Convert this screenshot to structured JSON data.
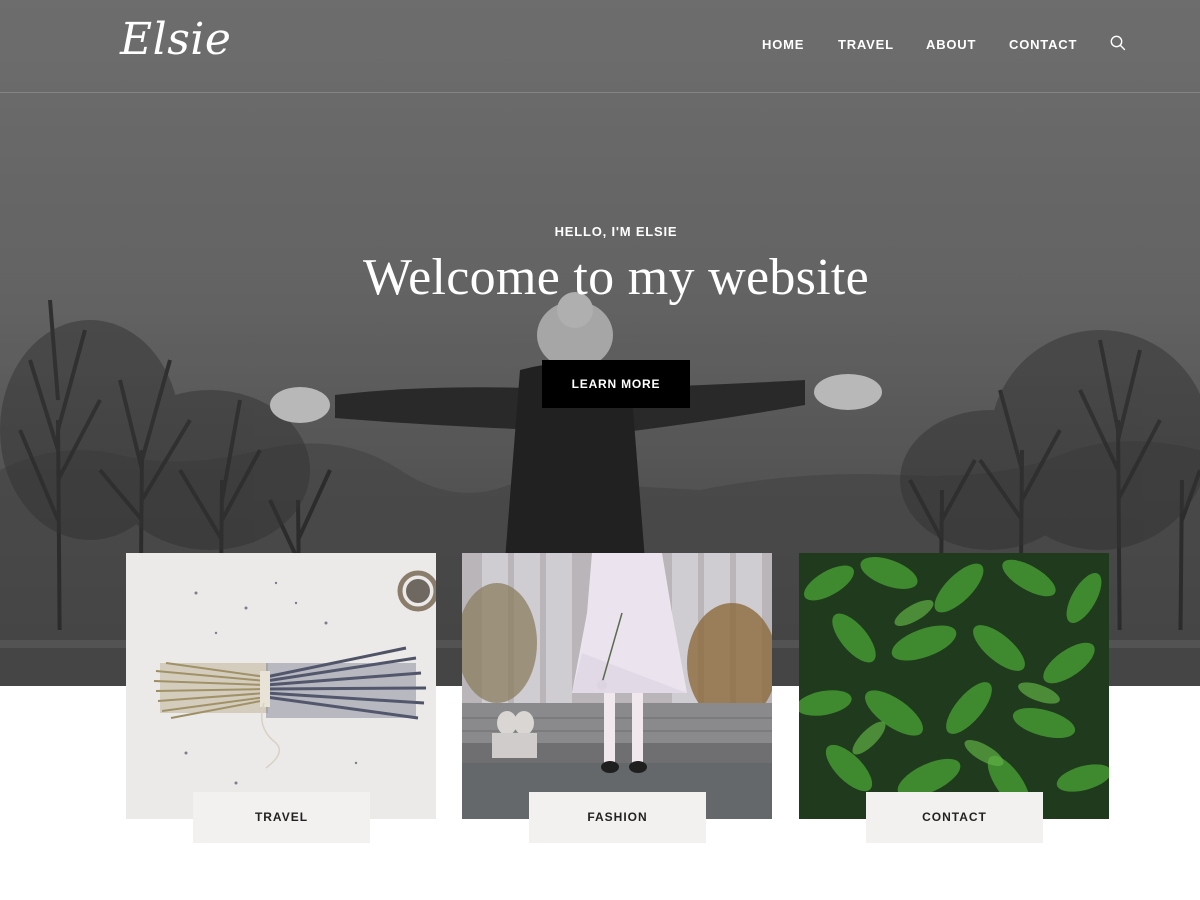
{
  "site": {
    "logo": "Elsie"
  },
  "nav": {
    "items": [
      {
        "label": "HOME"
      },
      {
        "label": "TRAVEL"
      },
      {
        "label": "ABOUT"
      },
      {
        "label": "CONTACT"
      }
    ],
    "search_icon": "search-icon"
  },
  "hero": {
    "eyebrow": "HELLO, I'M ELSIE",
    "title": "Welcome to my website",
    "button_label": "LEARN MORE",
    "button_color": "#000000"
  },
  "cards": [
    {
      "label": "TRAVEL",
      "image": "dried-flower-bundle"
    },
    {
      "label": "FASHION",
      "image": "woman-in-white-dress"
    },
    {
      "label": "CONTACT",
      "image": "green-leaves"
    }
  ]
}
